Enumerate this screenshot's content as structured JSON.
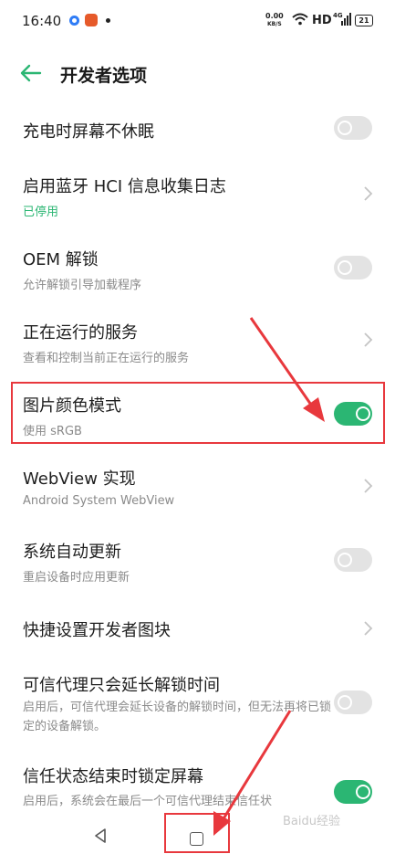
{
  "status_bar": {
    "time": "16:40",
    "net_speed_top": "0.00",
    "net_speed_unit": "KB/S",
    "hd": "HD",
    "network": "4G",
    "battery": "21"
  },
  "header": {
    "back_icon": "arrow-left-icon",
    "title": "开发者选项"
  },
  "settings": [
    {
      "title": "充电时屏幕不休眠",
      "subtitle": "",
      "control": "toggle",
      "state": "off"
    },
    {
      "title": "启用蓝牙 HCI 信息收集日志",
      "subtitle": "已停用",
      "control": "chevron"
    },
    {
      "title": "OEM 解锁",
      "subtitle": "允许解锁引导加载程序",
      "control": "toggle",
      "state": "off"
    },
    {
      "title": "正在运行的服务",
      "subtitle": "查看和控制当前正在运行的服务",
      "control": "chevron"
    },
    {
      "title": "图片颜色模式",
      "subtitle": "使用 sRGB",
      "control": "toggle",
      "state": "on"
    },
    {
      "title": "WebView 实现",
      "subtitle": "Android System WebView",
      "control": "chevron"
    },
    {
      "title": "系统自动更新",
      "subtitle": "重启设备时应用更新",
      "control": "toggle",
      "state": "off"
    },
    {
      "title": "快捷设置开发者图块",
      "subtitle": "",
      "control": "chevron"
    },
    {
      "title": "可信代理只会延长解锁时间",
      "subtitle": "启用后，可信代理会延长设备的解锁时间，但无法再将已锁定的设备解锁。",
      "control": "toggle",
      "state": "off"
    },
    {
      "title": "信任状态结束时锁定屏幕",
      "subtitle": "启用后，系统会在最后一个可信代理结束信任状",
      "control": "toggle",
      "state": "on"
    }
  ],
  "watermark": "Baidu经验",
  "colors": {
    "accent": "#2bb673",
    "annotation": "#e8383d",
    "toggle_off": "#e3e3e3"
  }
}
